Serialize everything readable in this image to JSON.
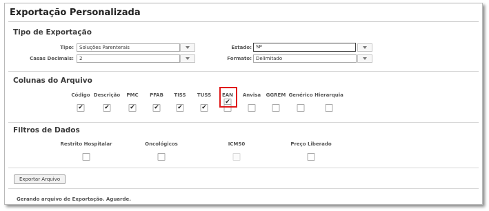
{
  "page_title": "Exportação Personalizada",
  "tipo_exportacao": {
    "heading": "Tipo de Exportação",
    "tipo": {
      "label": "Tipo:",
      "value": "Soluções Parenterais"
    },
    "casas_decimais": {
      "label": "Casas Decimais:",
      "value": "2"
    },
    "estado": {
      "label": "Estado:",
      "value": "SP"
    },
    "formato": {
      "label": "Formato:",
      "value": "Delimitado"
    }
  },
  "colunas": {
    "heading": "Colunas do Arquivo",
    "items": [
      {
        "label": "Código",
        "checked": true
      },
      {
        "label": "Descrição",
        "checked": true
      },
      {
        "label": "PMC",
        "checked": true
      },
      {
        "label": "PFAB",
        "checked": true
      },
      {
        "label": "TISS",
        "checked": true
      },
      {
        "label": "TUSS",
        "checked": true
      },
      {
        "label": "EAN",
        "checked": true
      },
      {
        "label": "Anvisa",
        "checked": false
      },
      {
        "label": "GGREM",
        "checked": false
      },
      {
        "label": "Genérico",
        "checked": false
      },
      {
        "label": "Hierarquia",
        "checked": false
      }
    ],
    "checkmark": "✔",
    "highlight_color": "#e01818"
  },
  "filtros": {
    "heading": "Filtros de Dados",
    "items": [
      {
        "label": "Restrito Hospitalar",
        "checked": false,
        "disabled": false
      },
      {
        "label": "Oncológicos",
        "checked": false,
        "disabled": false
      },
      {
        "label": "ICMS0",
        "checked": false,
        "disabled": true
      },
      {
        "label": "Preço Liberado",
        "checked": false,
        "disabled": false
      }
    ]
  },
  "actions": {
    "export_label": "Exportar Arquivo"
  },
  "status_text": "Gerando arquivo de Exportação. Aguarde."
}
